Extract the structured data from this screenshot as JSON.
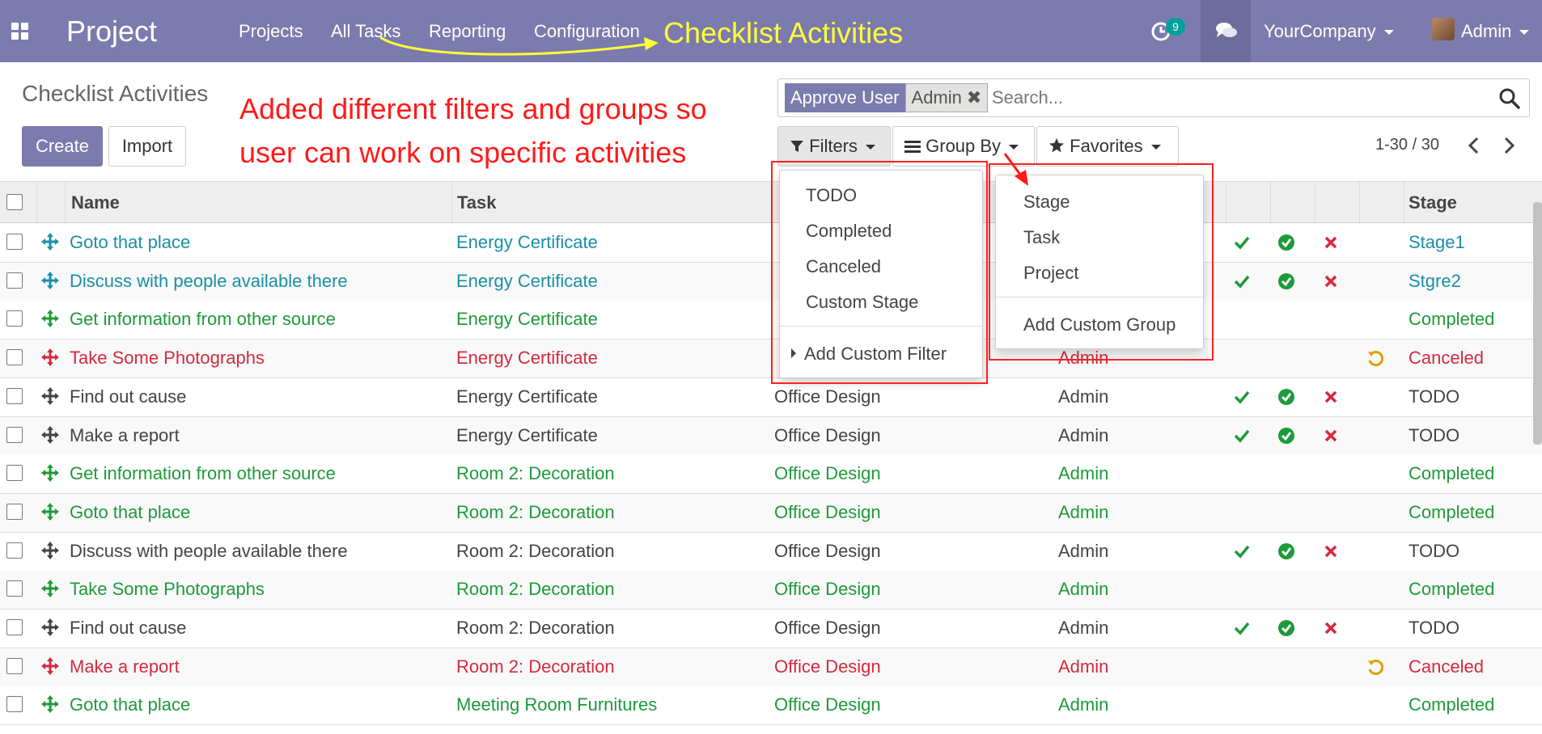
{
  "navbar": {
    "brand": "Project",
    "menus": [
      "Projects",
      "All Tasks",
      "Reporting",
      "Configuration"
    ],
    "annotation": "Checklist Activities",
    "activity_count": "9",
    "company": "YourCompany",
    "user": "Admin"
  },
  "control_panel": {
    "breadcrumb": "Checklist Activities",
    "create_label": "Create",
    "import_label": "Import",
    "annotation_line1": "Added different filters and groups so",
    "annotation_line2": "user can work on specific activities",
    "facet_category": "Approve User",
    "facet_value": "Admin",
    "search_placeholder": "Search...",
    "filters_label": "Filters",
    "groupby_label": "Group By",
    "favorites_label": "Favorites",
    "pager": "1-30 / 30"
  },
  "filters_menu": {
    "items": [
      "TODO",
      "Completed",
      "Canceled",
      "Custom Stage"
    ],
    "custom": "Add Custom Filter"
  },
  "groupby_menu": {
    "items": [
      "Stage",
      "Task",
      "Project"
    ],
    "custom": "Add Custom Group"
  },
  "table": {
    "headers": {
      "name": "Name",
      "task": "Task",
      "stage": "Stage"
    },
    "rows": [
      {
        "name": "Goto that place",
        "task": "Energy Certificate",
        "project": "",
        "user": "",
        "stage": "Stage1",
        "color": "blue",
        "actions": true,
        "undo": false
      },
      {
        "name": "Discuss with people available there",
        "task": "Energy Certificate",
        "project": "",
        "user": "",
        "stage": "Stgre2",
        "color": "blue",
        "actions": true,
        "undo": false
      },
      {
        "name": "Get information from other source",
        "task": "Energy Certificate",
        "project": "",
        "user": "",
        "stage": "Completed",
        "color": "green",
        "actions": false,
        "undo": false
      },
      {
        "name": "Take Some Photographs",
        "task": "Energy Certificate",
        "project": "",
        "user": "Admin",
        "stage": "Canceled",
        "color": "red",
        "actions": false,
        "undo": true
      },
      {
        "name": "Find out cause",
        "task": "Energy Certificate",
        "project": "Office Design",
        "user": "Admin",
        "stage": "TODO",
        "color": "gray",
        "actions": true,
        "undo": false
      },
      {
        "name": "Make a report",
        "task": "Energy Certificate",
        "project": "Office Design",
        "user": "Admin",
        "stage": "TODO",
        "color": "gray",
        "actions": true,
        "undo": false
      },
      {
        "name": "Get information from other source",
        "task": "Room 2: Decoration",
        "project": "Office Design",
        "user": "Admin",
        "stage": "Completed",
        "color": "green",
        "actions": false,
        "undo": false
      },
      {
        "name": "Goto that place",
        "task": "Room 2: Decoration",
        "project": "Office Design",
        "user": "Admin",
        "stage": "Completed",
        "color": "green",
        "actions": false,
        "undo": false
      },
      {
        "name": "Discuss with people available there",
        "task": "Room 2: Decoration",
        "project": "Office Design",
        "user": "Admin",
        "stage": "TODO",
        "color": "gray",
        "actions": true,
        "undo": false
      },
      {
        "name": "Take Some Photographs",
        "task": "Room 2: Decoration",
        "project": "Office Design",
        "user": "Admin",
        "stage": "Completed",
        "color": "green",
        "actions": false,
        "undo": false
      },
      {
        "name": "Find out cause",
        "task": "Room 2: Decoration",
        "project": "Office Design",
        "user": "Admin",
        "stage": "TODO",
        "color": "gray",
        "actions": true,
        "undo": false
      },
      {
        "name": "Make a report",
        "task": "Room 2: Decoration",
        "project": "Office Design",
        "user": "Admin",
        "stage": "Canceled",
        "color": "red",
        "actions": false,
        "undo": true
      },
      {
        "name": "Goto that place",
        "task": "Meeting Room Furnitures",
        "project": "Office Design",
        "user": "Admin",
        "stage": "Completed",
        "color": "green",
        "actions": false,
        "undo": false
      }
    ]
  },
  "colors": {
    "navbar": "#7c7bad",
    "blue": "#1a8fa8",
    "green": "#1e9a3a",
    "red": "#d42a3e",
    "gray": "#444444",
    "undo": "#e0a100",
    "annotation_yellow": "#ffff3c",
    "annotation_red": "#ff1a1a"
  }
}
